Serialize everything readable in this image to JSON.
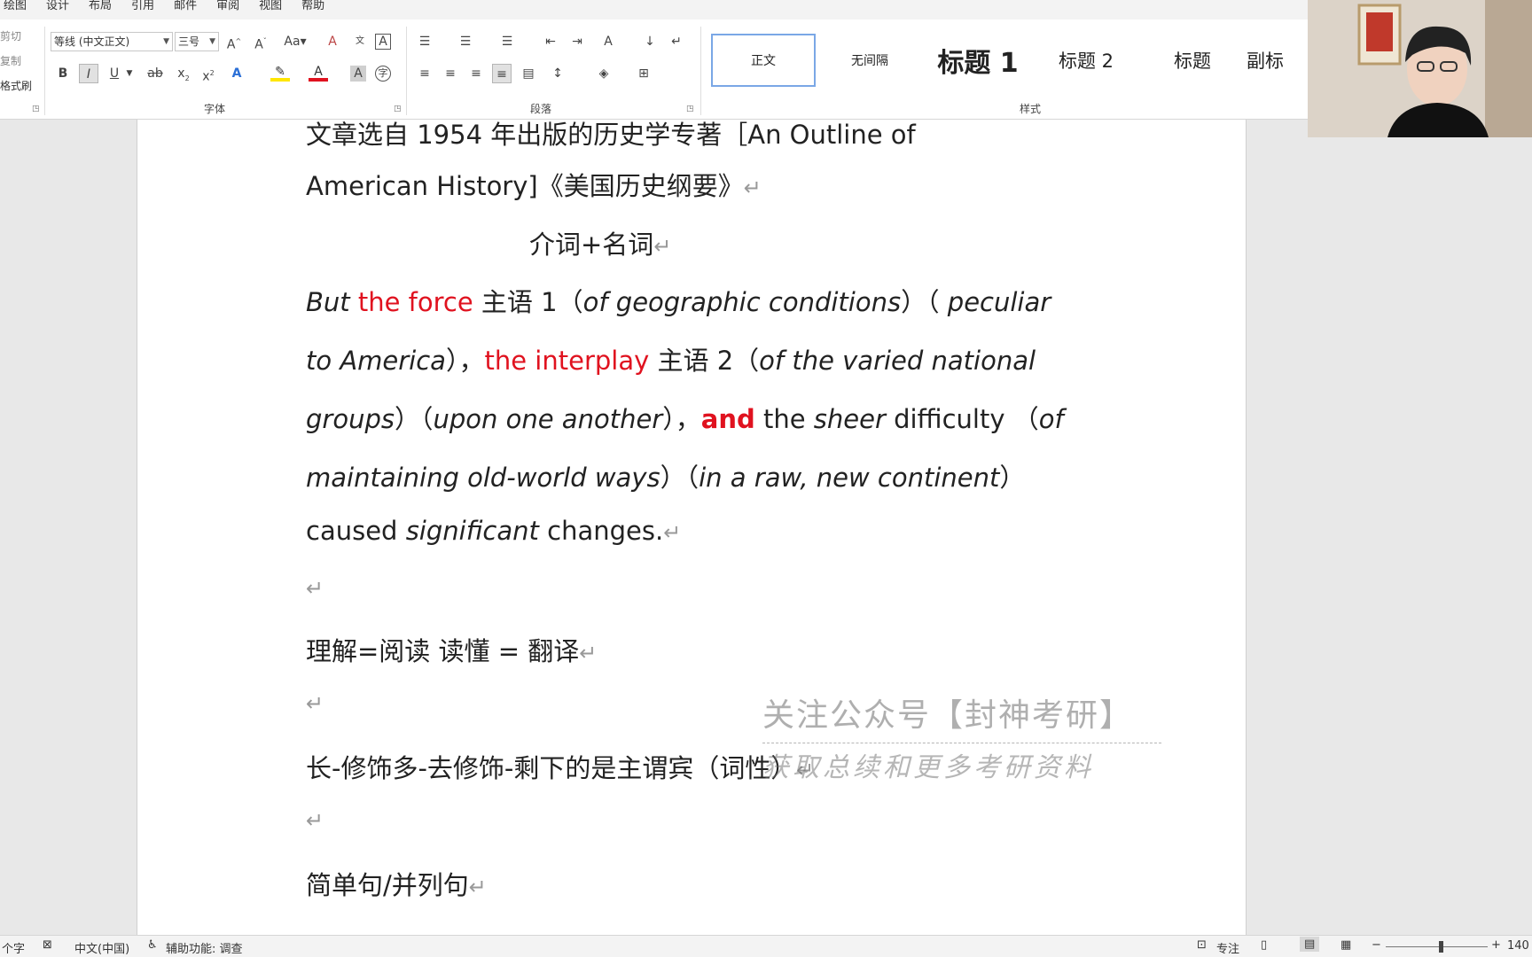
{
  "menu": [
    "绘图",
    "设计",
    "布局",
    "引用",
    "邮件",
    "审阅",
    "视图",
    "帮助"
  ],
  "clipboard": {
    "cut": "剪切",
    "copy": "复制",
    "painter": "格式刷"
  },
  "font": {
    "name": "等线 (中文正文)",
    "size": "三号",
    "group_label": "字体"
  },
  "paragraph": {
    "group_label": "段落"
  },
  "styles": {
    "group_label": "样式",
    "items": [
      "正文",
      "无间隔",
      "标题 1",
      "标题 2",
      "标题",
      "副标"
    ]
  },
  "doc": {
    "l1": "文章选自 1954 年出版的历史学专著［An Outline of",
    "l2": "American History]《美国历史纲要》",
    "l3": "介词+名词",
    "s1": [
      "But ",
      "the force",
      " 主语 1（",
      "of geographic conditions",
      "）（ ",
      "peculiar"
    ],
    "s2": [
      "to America",
      "），",
      "the interplay",
      " 主语 2（",
      "of the varied national"
    ],
    "s3": [
      "groups",
      "）（",
      "upon one another",
      "），",
      "and",
      " the ",
      "sheer",
      " difficulty （",
      "of"
    ],
    "s4": [
      "maintaining old-world ways",
      "）（",
      "in a raw, new continent",
      "）"
    ],
    "s5": [
      "caused ",
      "significant",
      " changes."
    ],
    "l6": "理解=阅读  读懂  =  翻译",
    "l7": "长-修饰多-去修饰-剩下的是主谓宾（词性）",
    "l8": "简单句/并列句",
    "para_mark": "↵"
  },
  "watermark": {
    "line1": "关注公众号【封神考研】",
    "line2": "获取总续和更多考研资料"
  },
  "status": {
    "words": "个字",
    "lang": "中文(中国)",
    "access": "辅助功能: 调查",
    "focus": "专注",
    "zoom": "140"
  },
  "colors": {
    "accent": "#e0121f"
  }
}
